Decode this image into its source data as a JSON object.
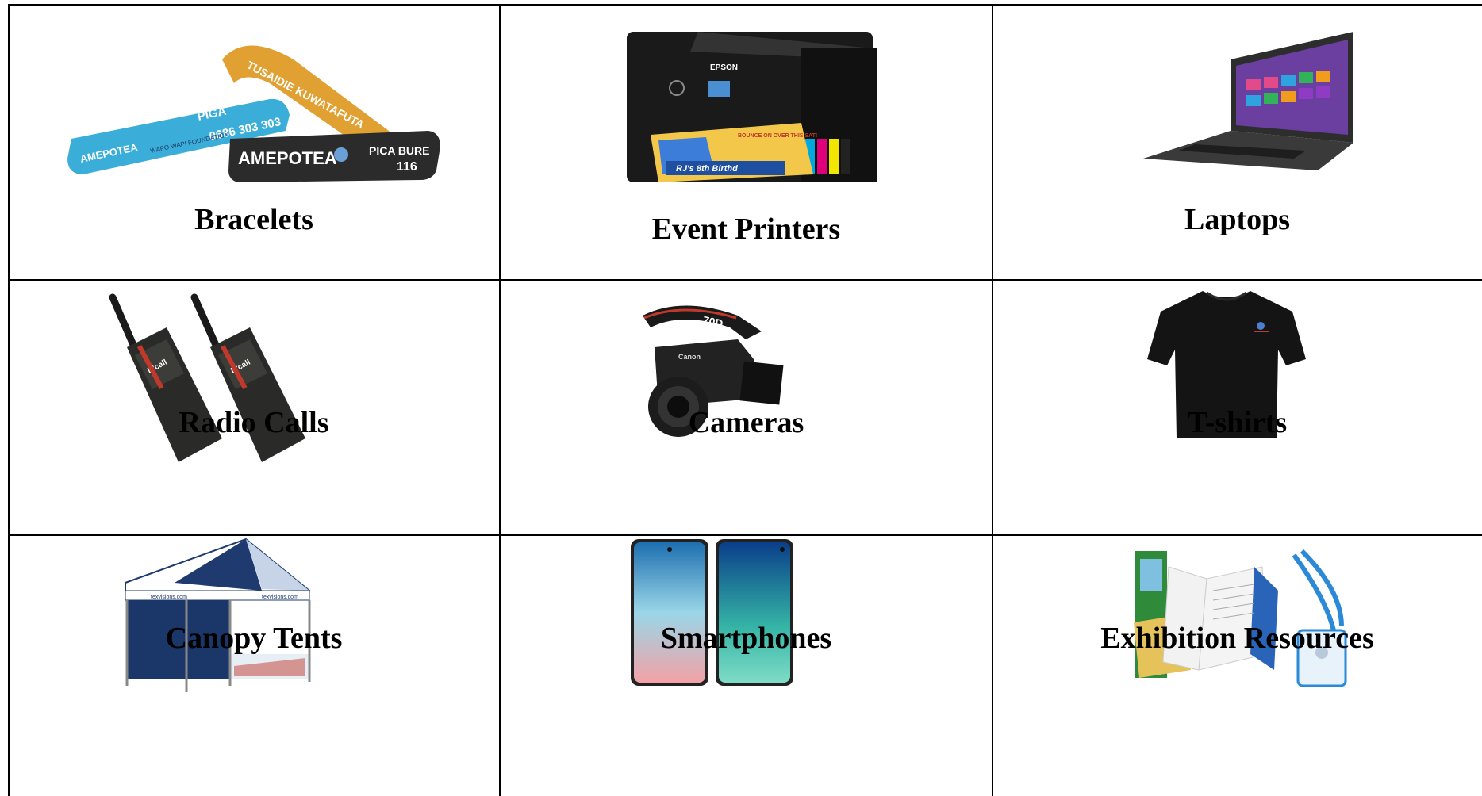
{
  "items": [
    {
      "label": "Bracelets",
      "icon": "bracelets-image",
      "band_texts": [
        "TUSAIDIE KUWATAFUTA",
        "PIGA",
        "0686 303 303",
        "AMEPOTEA",
        "WAPO WAPI FOUNDATION",
        "AMEPOTEA",
        "PICA BURE",
        "116"
      ]
    },
    {
      "label": "Event Printers",
      "icon": "printer-image",
      "brand": "EPSON",
      "print_texts": [
        "BOUNCE ON OVER THIS SAT!",
        "RJ's 8th Birthd"
      ]
    },
    {
      "label": "Laptops",
      "icon": "laptop-image"
    },
    {
      "label": "Radio Calls",
      "icon": "walkie-talkie-image",
      "brand": "D'call"
    },
    {
      "label": "Cameras",
      "icon": "camera-image",
      "model": "70D",
      "brand": "Canon"
    },
    {
      "label": "T-shirts",
      "icon": "tshirt-image"
    },
    {
      "label": "Canopy Tents",
      "icon": "canopy-tent-image",
      "canopy_text": "texvisions.com"
    },
    {
      "label": "Smartphones",
      "icon": "smartphone-image"
    },
    {
      "label": "Exhibition Resources",
      "icon": "exhibition-resources-image"
    }
  ]
}
